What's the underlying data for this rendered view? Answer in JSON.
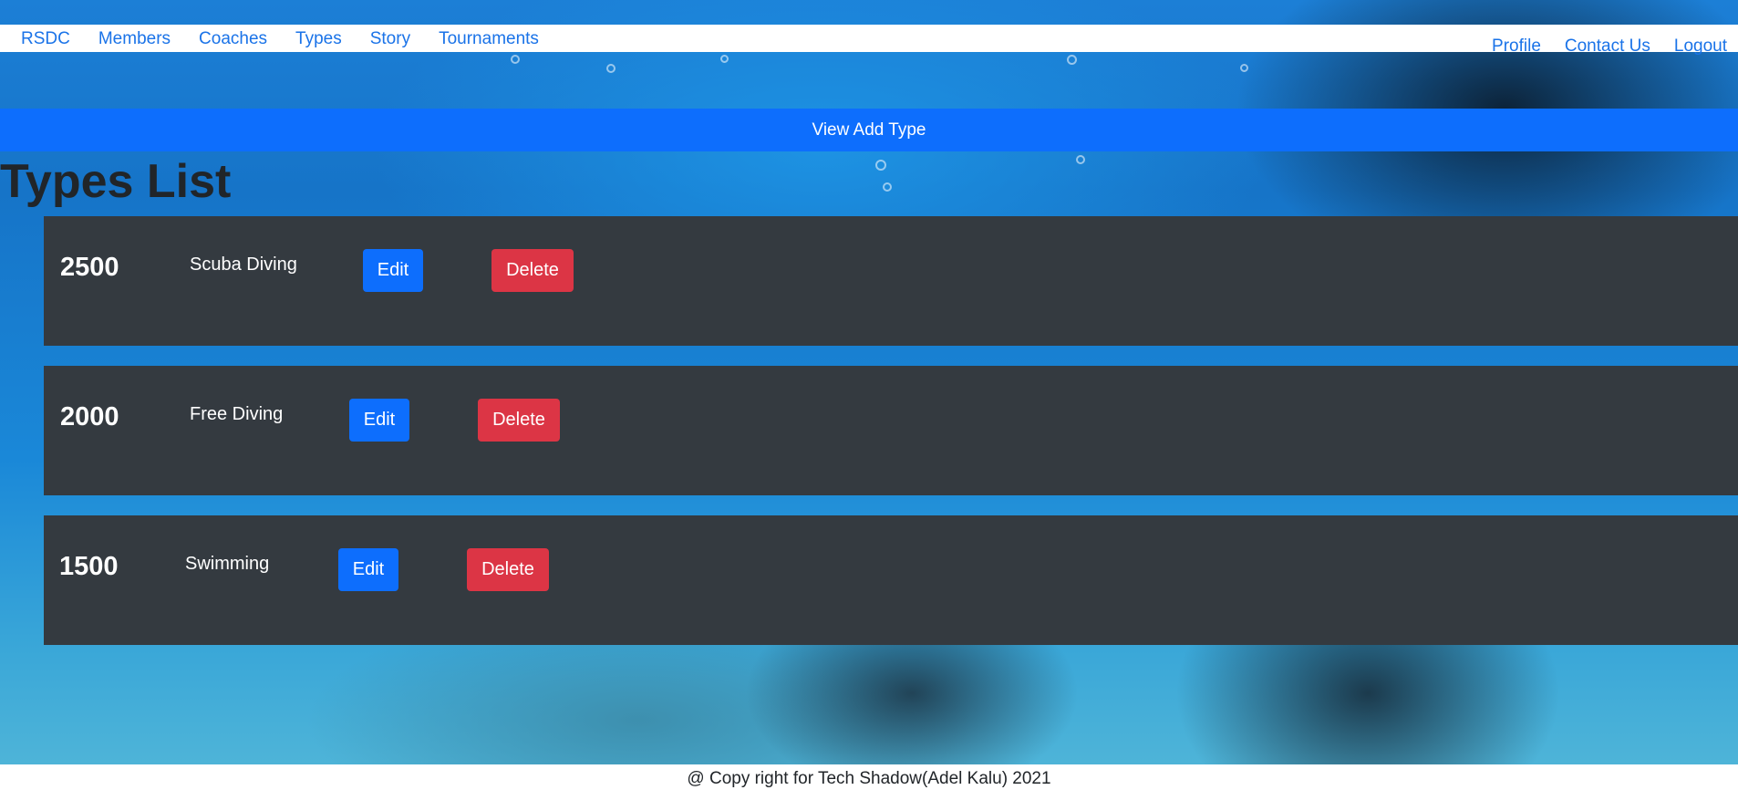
{
  "nav": {
    "left": [
      {
        "label": "RSDC"
      },
      {
        "label": "Members"
      },
      {
        "label": "Coaches"
      },
      {
        "label": "Types"
      },
      {
        "label": "Story"
      },
      {
        "label": "Tournaments"
      }
    ],
    "right": [
      {
        "label": "Profile"
      },
      {
        "label": "Contact Us"
      },
      {
        "label": "Logout"
      }
    ]
  },
  "add_bar": {
    "label": "View Add Type"
  },
  "page": {
    "title": "Types List"
  },
  "types": [
    {
      "price": "2500",
      "name": "Scuba Diving",
      "edit_label": "Edit",
      "delete_label": "Delete"
    },
    {
      "price": "2000",
      "name": "Free Diving",
      "edit_label": "Edit",
      "delete_label": "Delete"
    },
    {
      "price": "1500",
      "name": "Swimming",
      "edit_label": "Edit",
      "delete_label": "Delete"
    }
  ],
  "footer": {
    "text": "@ Copy right for Tech Shadow(Adel Kalu) 2021"
  },
  "colors": {
    "primary": "#0d6efd",
    "danger": "#dc3545",
    "card": "#343a40",
    "link": "#1a73e8"
  }
}
